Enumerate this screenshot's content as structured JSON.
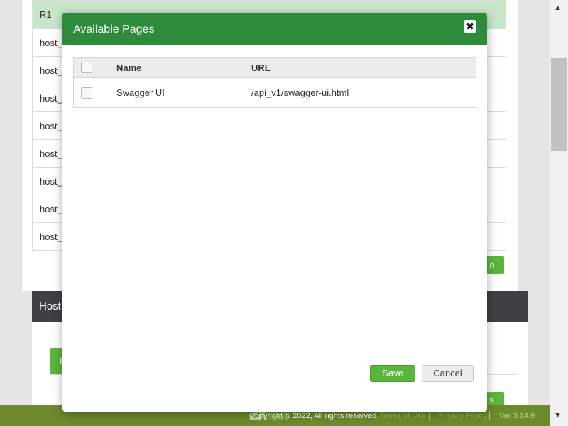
{
  "background": {
    "table_rows": [
      {
        "label": "R1",
        "group": true
      },
      {
        "label": "host_",
        "group": false
      },
      {
        "label": "host_",
        "group": false
      },
      {
        "label": "host_",
        "group": false
      },
      {
        "label": "host_",
        "group": false
      },
      {
        "label": "host_",
        "group": false
      },
      {
        "label": "host_",
        "group": false
      },
      {
        "label": "host_",
        "group": false
      },
      {
        "label": "host_",
        "group": false
      }
    ],
    "green_button_label": "e",
    "section_title": "Host",
    "tab_label": "I",
    "bottom_button_label": "s"
  },
  "footer": {
    "logo_main": "ZK",
    "logo_sub": "Teco",
    "copyright": "Copyright © 2022, All rights reserved.",
    "terms": "Terms of Use",
    "privacy": "Privacy Policy",
    "version": "Ver 3.14.9"
  },
  "modal": {
    "title": "Available Pages",
    "close_icon": "close-icon",
    "columns": [
      "",
      "Name",
      "URL"
    ],
    "rows": [
      {
        "name": "Swagger UI",
        "url": "/api_v1/swagger-ui.html",
        "checked": false
      }
    ],
    "save_label": "Save",
    "cancel_label": "Cancel"
  },
  "colors": {
    "header_green": "#2f8b3c",
    "accent_green": "#5ab63b",
    "footer_green": "#6d8a2c"
  }
}
